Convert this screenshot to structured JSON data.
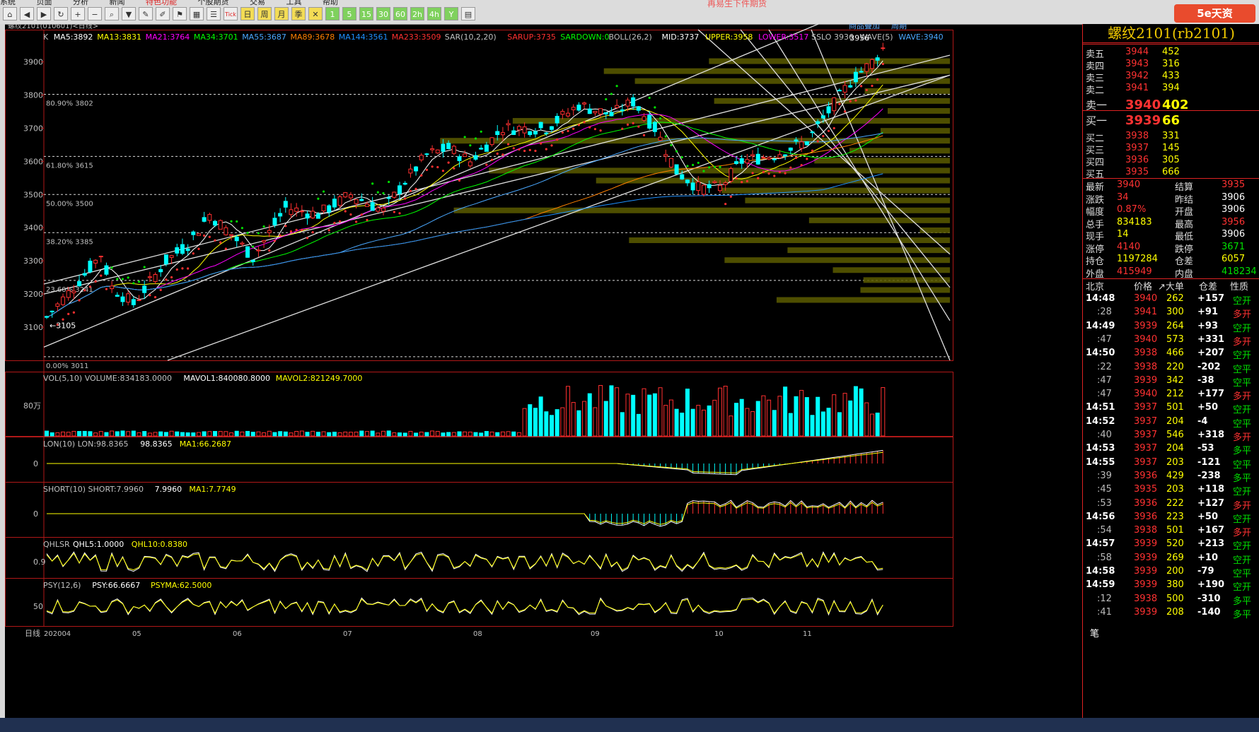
{
  "window": {
    "menu": [
      "系统",
      "页面",
      "分析",
      "新闻",
      "特色功能",
      "个股期货",
      "交易",
      "工具",
      "帮助"
    ],
    "title_text": "再易生下件期货",
    "logo": "5e天资",
    "toolbar_labels": [
      "日",
      "周",
      "月",
      "季",
      "1",
      "5",
      "15",
      "30",
      "60",
      "2h",
      "4h"
    ]
  },
  "chart_header": {
    "symbol": "螺纹2101(010601)<日线>",
    "links": [
      "商品叠加",
      "周期"
    ]
  },
  "main_legend": [
    {
      "text": "K",
      "color": "#c0c0c0"
    },
    {
      "text": "MA5:3892",
      "color": "#ffffff"
    },
    {
      "text": "MA13:3831",
      "color": "#ffff00"
    },
    {
      "text": "MA21:3764",
      "color": "#ff00ff"
    },
    {
      "text": "MA34:3701",
      "color": "#00ff00"
    },
    {
      "text": "MA55:3687",
      "color": "#4aa8ff"
    },
    {
      "text": "MA89:3678",
      "color": "#ff8000"
    },
    {
      "text": "MA144:3561",
      "color": "#1e90ff"
    },
    {
      "text": "MA233:3509",
      "color": "#ff3030"
    },
    {
      "text": "SAR(10,2,20)",
      "color": "#c0c0c0"
    },
    {
      "text": "SARUP:3735",
      "color": "#ff3030"
    },
    {
      "text": "SARDOWN:0",
      "color": "#00ff00"
    },
    {
      "text": "BOLL(26,2)",
      "color": "#c0c0c0"
    },
    {
      "text": "MID:3737",
      "color": "#ffffff"
    },
    {
      "text": "UPPER:3958",
      "color": "#ffff00"
    },
    {
      "text": "LOWER:3517",
      "color": "#ff00ff"
    },
    {
      "text": "SSLO 3936",
      "color": "#c0c0c0"
    },
    {
      "text": "WAVE(5)",
      "color": "#c0c0c0"
    },
    {
      "text": "WAVE:3940",
      "color": "#4aa8ff"
    }
  ],
  "fib_levels": [
    {
      "label": "80.90% 3802",
      "value": 3802
    },
    {
      "label": "61.80% 3615",
      "value": 3615
    },
    {
      "label": "50.00% 3500",
      "value": 3500
    },
    {
      "label": "38.20% 3385",
      "value": 3385
    },
    {
      "label": "23.60% 3241",
      "value": 3241
    },
    {
      "label": "0.00% 3011",
      "value": 3011
    }
  ],
  "annotations": {
    "low": "3105",
    "high": "3956"
  },
  "volume_legend": [
    {
      "text": "VOL(5,10) VOLUME:834183.0000",
      "color": "#c0c0c0"
    },
    {
      "text": "MAVOL1:840080.8000",
      "color": "#ffffff"
    },
    {
      "text": "MAVOL2:821249.7000",
      "color": "#ffff00"
    }
  ],
  "volume_axis": "80万",
  "lon_legend": [
    {
      "text": "LON(10) LON:98.8365",
      "color": "#c0c0c0"
    },
    {
      "text": "98.8365",
      "color": "#ffffff"
    },
    {
      "text": "MA1:66.2687",
      "color": "#ffff00"
    }
  ],
  "lon_axis": "0",
  "short_legend": [
    {
      "text": "SHORT(10) SHORT:7.9960",
      "color": "#c0c0c0"
    },
    {
      "text": "7.9960",
      "color": "#ffffff"
    },
    {
      "text": "MA1:7.7749",
      "color": "#ffff00"
    }
  ],
  "short_axis": "0",
  "qhl_legend": [
    {
      "text": "QHLSR",
      "color": "#c0c0c0"
    },
    {
      "text": "QHL5:1.0000",
      "color": "#ffffff"
    },
    {
      "text": "QHL10:0.8380",
      "color": "#ffff00"
    }
  ],
  "qhl_axis": "0.9",
  "psy_legend": [
    {
      "text": "PSY(12,6)",
      "color": "#c0c0c0"
    },
    {
      "text": "PSY:66.6667",
      "color": "#ffffff"
    },
    {
      "text": "PSYMA:62.5000",
      "color": "#ffff00"
    }
  ],
  "psy_axis": "50",
  "x_axis": {
    "label": "日线",
    "ticks": [
      "202004",
      "05",
      "06",
      "07",
      "08",
      "09",
      "10",
      "11"
    ]
  },
  "chart_data": {
    "type": "candlestick",
    "y_ticks": [
      3100,
      3200,
      3300,
      3400,
      3500,
      3600,
      3700,
      3800,
      3900
    ],
    "ylim": [
      3000,
      3980
    ],
    "num_bars": 155,
    "price_path": [
      {
        "bar": 0,
        "price": 3130
      },
      {
        "bar": 6,
        "price": 3240
      },
      {
        "bar": 10,
        "price": 3320
      },
      {
        "bar": 12,
        "price": 3220
      },
      {
        "bar": 16,
        "price": 3170
      },
      {
        "bar": 22,
        "price": 3300
      },
      {
        "bar": 26,
        "price": 3350
      },
      {
        "bar": 30,
        "price": 3440
      },
      {
        "bar": 34,
        "price": 3380
      },
      {
        "bar": 38,
        "price": 3310
      },
      {
        "bar": 44,
        "price": 3460
      },
      {
        "bar": 50,
        "price": 3440
      },
      {
        "bar": 56,
        "price": 3500
      },
      {
        "bar": 62,
        "price": 3450
      },
      {
        "bar": 66,
        "price": 3540
      },
      {
        "bar": 70,
        "price": 3620
      },
      {
        "bar": 74,
        "price": 3640
      },
      {
        "bar": 78,
        "price": 3600
      },
      {
        "bar": 84,
        "price": 3700
      },
      {
        "bar": 92,
        "price": 3700
      },
      {
        "bar": 98,
        "price": 3770
      },
      {
        "bar": 104,
        "price": 3740
      },
      {
        "bar": 108,
        "price": 3780
      },
      {
        "bar": 112,
        "price": 3700
      },
      {
        "bar": 116,
        "price": 3570
      },
      {
        "bar": 120,
        "price": 3520
      },
      {
        "bar": 124,
        "price": 3520
      },
      {
        "bar": 128,
        "price": 3600
      },
      {
        "bar": 134,
        "price": 3620
      },
      {
        "bar": 140,
        "price": 3660
      },
      {
        "bar": 144,
        "price": 3750
      },
      {
        "bar": 148,
        "price": 3840
      },
      {
        "bar": 152,
        "price": 3900
      },
      {
        "bar": 154,
        "price": 3940
      }
    ]
  },
  "quote": {
    "title": "螺纹2101(rb2101)",
    "asks": [
      {
        "label": "卖五",
        "price": "3944",
        "vol": "452"
      },
      {
        "label": "卖四",
        "price": "3943",
        "vol": "316"
      },
      {
        "label": "卖三",
        "price": "3942",
        "vol": "433"
      },
      {
        "label": "卖二",
        "price": "3941",
        "vol": "394"
      },
      {
        "label": "卖一",
        "price": "3940",
        "vol": "402"
      }
    ],
    "bids": [
      {
        "label": "买一",
        "price": "3939",
        "vol": "66"
      },
      {
        "label": "买二",
        "price": "3938",
        "vol": "331"
      },
      {
        "label": "买三",
        "price": "3937",
        "vol": "145"
      },
      {
        "label": "买四",
        "price": "3936",
        "vol": "305"
      },
      {
        "label": "买五",
        "price": "3935",
        "vol": "666"
      }
    ],
    "stats": [
      {
        "l1": "最新",
        "v1": "3940",
        "c1": "red",
        "l2": "结算",
        "v2": "3935",
        "c2": "red"
      },
      {
        "l1": "涨跌",
        "v1": "34",
        "c1": "red",
        "l2": "昨结",
        "v2": "3906",
        "c2": "white"
      },
      {
        "l1": "幅度",
        "v1": "0.87%",
        "c1": "red",
        "l2": "开盘",
        "v2": "3906",
        "c2": "white"
      },
      {
        "l1": "总手",
        "v1": "834183",
        "c1": "yellow",
        "l2": "最高",
        "v2": "3956",
        "c2": "red"
      },
      {
        "l1": "现手",
        "v1": "14",
        "c1": "yellow",
        "l2": "最低",
        "v2": "3906",
        "c2": "white"
      },
      {
        "l1": "涨停",
        "v1": "4140",
        "c1": "red",
        "l2": "跌停",
        "v2": "3671",
        "c2": "green"
      },
      {
        "l1": "持仓",
        "v1": "1197284",
        "c1": "yellow",
        "l2": "仓差",
        "v2": "6057",
        "c2": "yellow"
      },
      {
        "l1": "外盘",
        "v1": "415949",
        "c1": "red",
        "l2": "内盘",
        "v2": "418234",
        "c2": "green"
      }
    ],
    "tick_header": [
      "北京",
      "价格",
      "↗大单",
      "仓差",
      "性质"
    ],
    "ticks": [
      {
        "time": "14:48",
        "price": "3940",
        "vol": "262",
        "diff": "+157",
        "kind": "空开",
        "kc": "green"
      },
      {
        "time": ":28",
        "price": "3941",
        "vol": "300",
        "diff": "+91",
        "kind": "多开",
        "kc": "red"
      },
      {
        "time": "14:49",
        "price": "3939",
        "vol": "264",
        "diff": "+93",
        "kind": "空开",
        "kc": "green"
      },
      {
        "time": ":47",
        "price": "3940",
        "vol": "573",
        "diff": "+331",
        "kind": "多开",
        "kc": "red"
      },
      {
        "time": "14:50",
        "price": "3938",
        "vol": "466",
        "diff": "+207",
        "kind": "空开",
        "kc": "green"
      },
      {
        "time": ":22",
        "price": "3938",
        "vol": "220",
        "diff": "-202",
        "kind": "空平",
        "kc": "green"
      },
      {
        "time": ":47",
        "price": "3939",
        "vol": "342",
        "diff": "-38",
        "kind": "空平",
        "kc": "green"
      },
      {
        "time": ":47",
        "price": "3940",
        "vol": "212",
        "diff": "+177",
        "kind": "多开",
        "kc": "red"
      },
      {
        "time": "14:51",
        "price": "3937",
        "vol": "501",
        "diff": "+50",
        "kind": "空开",
        "kc": "green"
      },
      {
        "time": "14:52",
        "price": "3937",
        "vol": "204",
        "diff": "-4",
        "kind": "空平",
        "kc": "green"
      },
      {
        "time": ":40",
        "price": "3937",
        "vol": "546",
        "diff": "+318",
        "kind": "多开",
        "kc": "red"
      },
      {
        "time": "14:53",
        "price": "3937",
        "vol": "204",
        "diff": "-53",
        "kind": "多平",
        "kc": "green"
      },
      {
        "time": "14:55",
        "price": "3937",
        "vol": "203",
        "diff": "-121",
        "kind": "空平",
        "kc": "green"
      },
      {
        "time": ":39",
        "price": "3936",
        "vol": "429",
        "diff": "-238",
        "kind": "多平",
        "kc": "green"
      },
      {
        "time": ":45",
        "price": "3935",
        "vol": "203",
        "diff": "+118",
        "kind": "空开",
        "kc": "green"
      },
      {
        "time": ":53",
        "price": "3936",
        "vol": "222",
        "diff": "+127",
        "kind": "多开",
        "kc": "red"
      },
      {
        "time": "14:56",
        "price": "3936",
        "vol": "223",
        "diff": "+50",
        "kind": "空开",
        "kc": "green"
      },
      {
        "time": ":54",
        "price": "3938",
        "vol": "501",
        "diff": "+167",
        "kind": "多开",
        "kc": "red"
      },
      {
        "time": "14:57",
        "price": "3939",
        "vol": "520",
        "diff": "+213",
        "kind": "空开",
        "kc": "green"
      },
      {
        "time": ":58",
        "price": "3939",
        "vol": "269",
        "diff": "+10",
        "kind": "空开",
        "kc": "green"
      },
      {
        "time": "14:58",
        "price": "3939",
        "vol": "200",
        "diff": "-79",
        "kind": "空平",
        "kc": "green"
      },
      {
        "time": "14:59",
        "price": "3939",
        "vol": "380",
        "diff": "+190",
        "kind": "空开",
        "kc": "green"
      },
      {
        "time": ":12",
        "price": "3938",
        "vol": "500",
        "diff": "-310",
        "kind": "多平",
        "kc": "green"
      },
      {
        "time": ":41",
        "price": "3939",
        "vol": "208",
        "diff": "-140",
        "kind": "多平",
        "kc": "green"
      }
    ],
    "footer_tab": "笔"
  }
}
